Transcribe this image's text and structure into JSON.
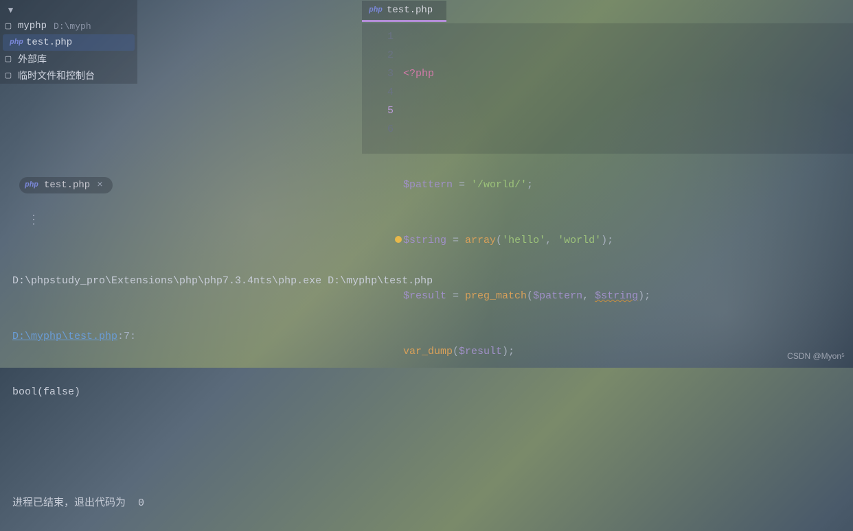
{
  "sidebar": {
    "project": {
      "name": "myphp",
      "path": "D:\\myph"
    },
    "file": "test.php",
    "external": "外部库",
    "scratches": "临时文件和控制台"
  },
  "icons": {
    "php": "php"
  },
  "editor": {
    "tab": "test.php",
    "gutter": [
      "1",
      "2",
      "3",
      "4",
      "5",
      "6"
    ],
    "currentLine": 5,
    "lines": {
      "l1_open": "<?php",
      "l3_var": "$pattern",
      "l3_eq": " = ",
      "l3_str": "'/world/'",
      "l3_end": ";",
      "l4_var": "$string",
      "l4_eq": " = ",
      "l4_fn": "array",
      "l4_p1": "(",
      "l4_sa": "'hello'",
      "l4_c": ", ",
      "l4_sb": "'world'",
      "l4_p2": ")",
      "l4_end": ";",
      "l5_var": "$result",
      "l5_eq": " = ",
      "l5_fn": "preg_match",
      "l5_p1": "(",
      "l5_a": "$pattern",
      "l5_c": ", ",
      "l5_b": "$string",
      "l5_p2": ")",
      "l5_end": ";",
      "l6_fn": "var_dump",
      "l6_p1": "(",
      "l6_a": "$result",
      "l6_p2": ")",
      "l6_end": ";"
    }
  },
  "run": {
    "tab": "test.php",
    "cmd": "D:\\phpstudy_pro\\Extensions\\php\\php7.3.4nts\\php.exe D:\\myphp\\test.php",
    "link": "D:\\myphp\\test.php",
    "loc": ":7:",
    "out": "bool(false)",
    "exit": "进程已结束，退出代码为  0"
  },
  "watermark": "CSDN @Myon⁵"
}
